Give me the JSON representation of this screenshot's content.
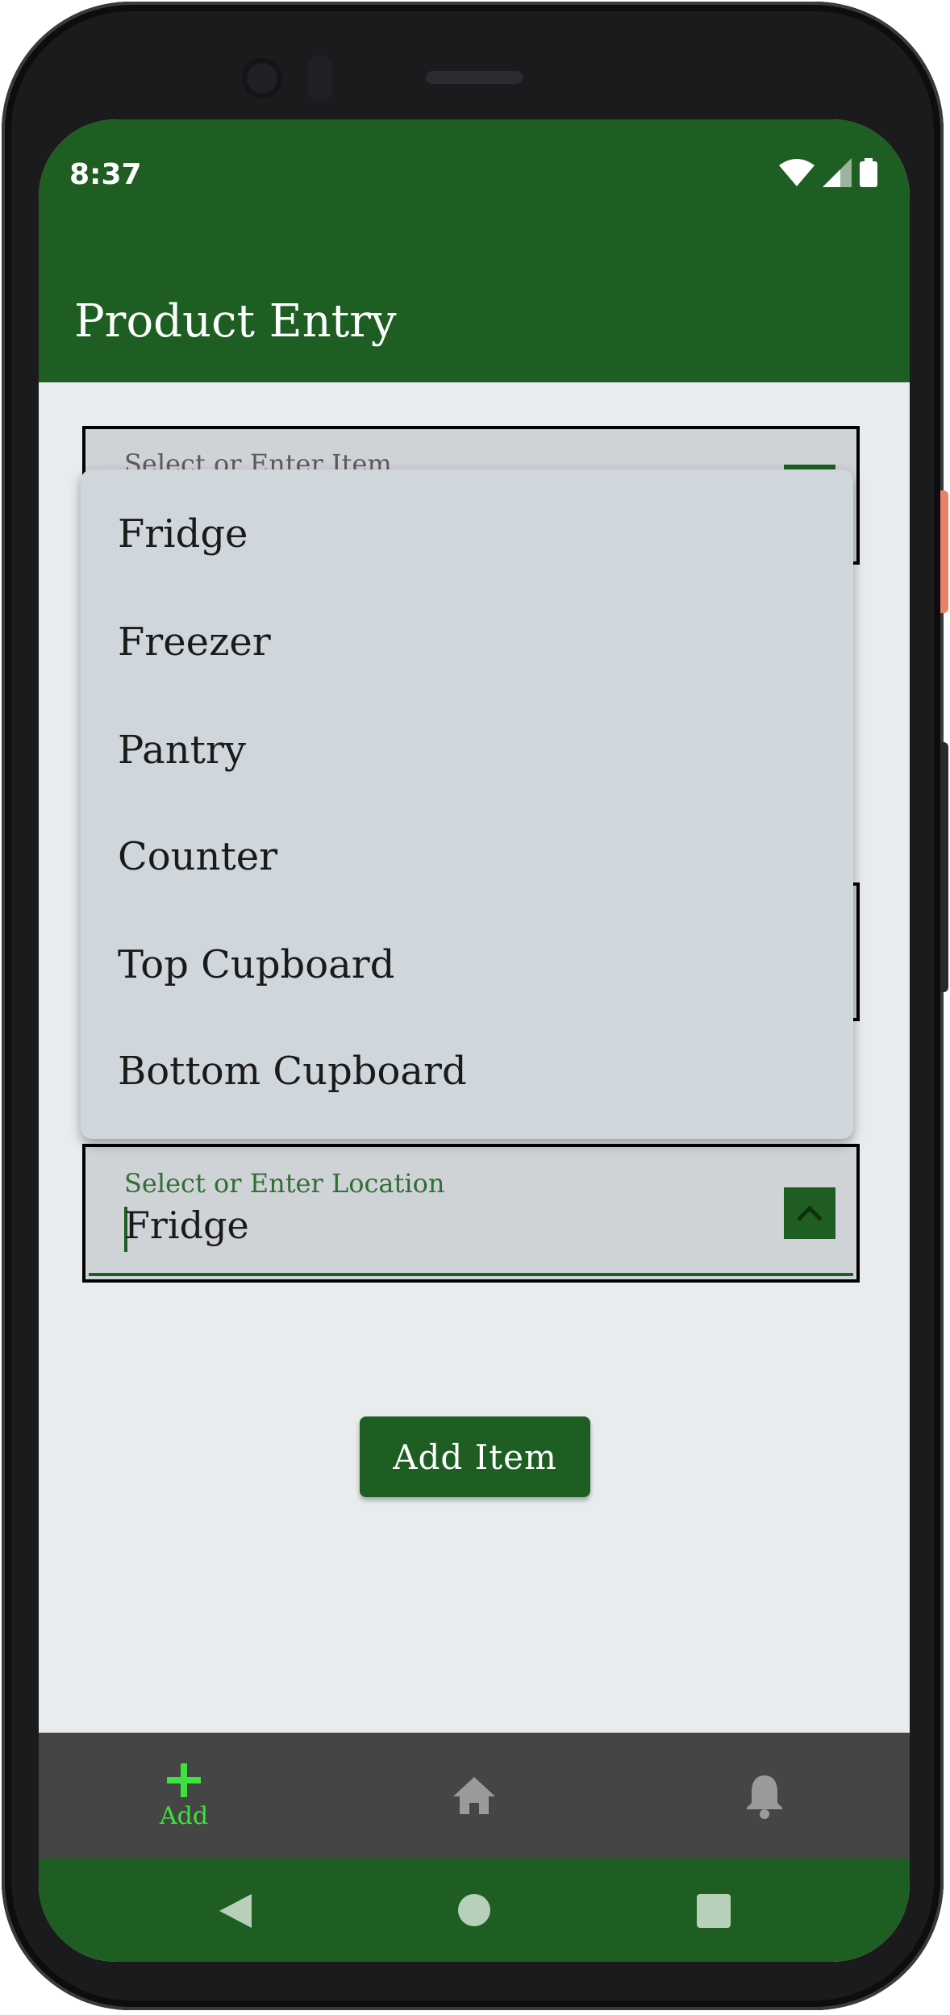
{
  "status_bar": {
    "time": "8:37"
  },
  "app_bar": {
    "title": "Product Entry"
  },
  "item_field": {
    "label": "Select or Enter Item"
  },
  "location_menu": {
    "options": [
      "Fridge",
      "Freezer",
      "Pantry",
      "Counter",
      "Top Cupboard",
      "Bottom Cupboard"
    ]
  },
  "location_field": {
    "label": "Select or Enter Location",
    "value": "Fridge"
  },
  "add_button": {
    "label": "Add Item"
  },
  "bottom_nav": {
    "items": [
      {
        "label": "Add",
        "icon": "plus-icon",
        "active": true
      },
      {
        "label": "",
        "icon": "home-icon",
        "active": false
      },
      {
        "label": "",
        "icon": "bell-icon",
        "active": false
      }
    ]
  },
  "colors": {
    "primary": "#1e5e22",
    "active_nav": "#3ee23e",
    "nav_bg": "#454545",
    "surface": "#e8ecee"
  }
}
